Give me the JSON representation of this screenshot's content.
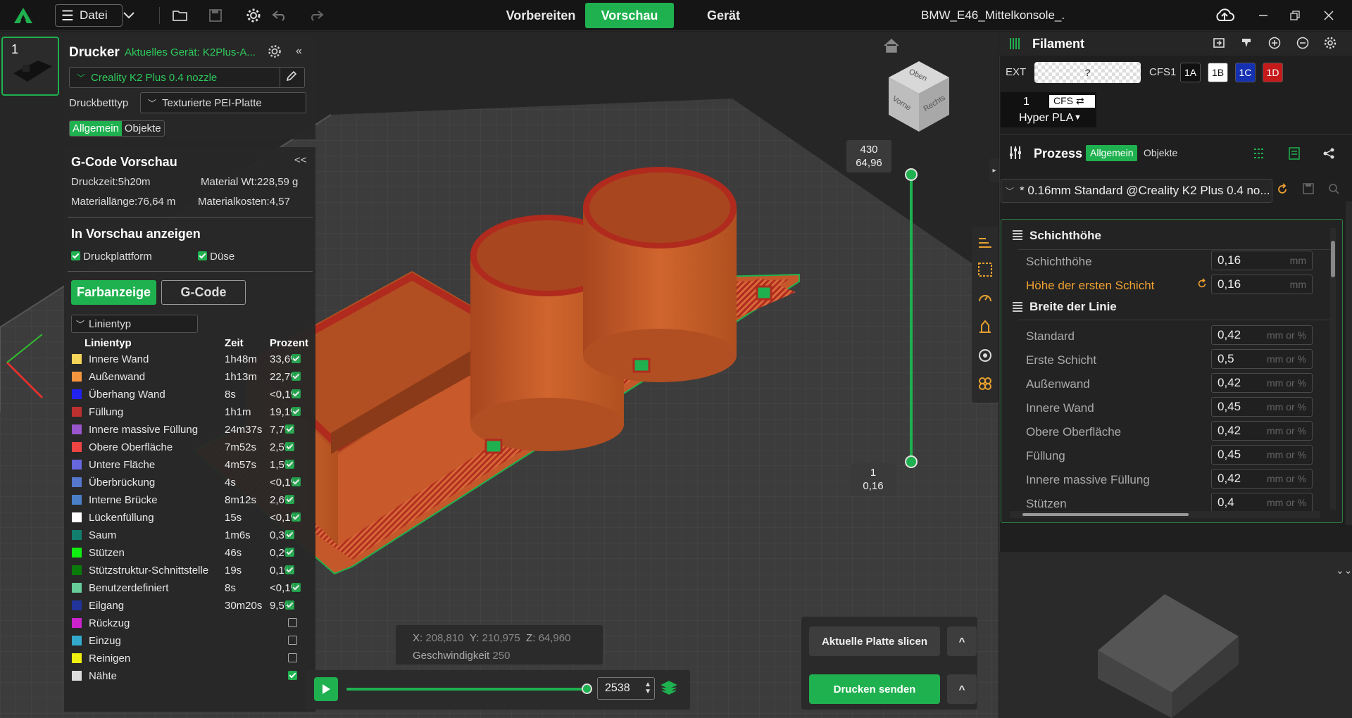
{
  "topbar": {
    "menu_label": "Datei",
    "tabs": [
      "Vorbereiten",
      "Vorschau",
      "Gerät"
    ],
    "active_tab": "Vorschau",
    "file_title": "BMW_E46_Mittelkonsole_."
  },
  "plate": {
    "number": "1"
  },
  "printer": {
    "title": "Drucker",
    "current_device": "Aktuelles Gerät: K2Plus-A...",
    "printer_select": "Creality K2 Plus 0.4 nozzle",
    "bed_label": "Druckbetttyp",
    "bed_value": "Texturierte PEI-Platte",
    "tabs": [
      "Allgemein",
      "Objekte"
    ]
  },
  "gcode_preview": {
    "title": "G-Code Vorschau",
    "collapse": "<<",
    "stats": {
      "print_time": "Druckzeit:5h20m",
      "material_wt": "Material Wt:228,59 g",
      "material_length": "Materiallänge:76,64 m",
      "material_cost": "Materialkosten:4,57"
    },
    "show_title": "In Vorschau anzeigen",
    "show_items": [
      "Druckplattform",
      "Düse"
    ],
    "view_tabs": [
      "Farbanzeige",
      "G-Code"
    ],
    "linetype_select": "Linientyp",
    "table": {
      "headers": [
        "Linientyp",
        "Zeit",
        "Prozent"
      ],
      "rows": [
        {
          "color": "#f5d45a",
          "name": "Innere Wand",
          "time": "1h48m",
          "pct": "33,6%"
        },
        {
          "color": "#f59540",
          "name": "Außenwand",
          "time": "1h13m",
          "pct": "22,7%"
        },
        {
          "color": "#2222ee",
          "name": "Überhang Wand",
          "time": "8s",
          "pct": "<0,1%"
        },
        {
          "color": "#bb3030",
          "name": "Füllung",
          "time": "1h1m",
          "pct": "19,1%"
        },
        {
          "color": "#9955cc",
          "name": "Innere massive Füllung",
          "time": "24m37s",
          "pct": "7,7%"
        },
        {
          "color": "#ee4444",
          "name": "Obere Oberfläche",
          "time": "7m52s",
          "pct": "2,5%"
        },
        {
          "color": "#6666dd",
          "name": "Untere Fläche",
          "time": "4m57s",
          "pct": "1,5%"
        },
        {
          "color": "#5577cc",
          "name": "Überbrückung",
          "time": "4s",
          "pct": "<0,1%"
        },
        {
          "color": "#4a7fc8",
          "name": "Interne Brücke",
          "time": "8m12s",
          "pct": "2,6%"
        },
        {
          "color": "#ffffff",
          "name": "Lückenfüllung",
          "time": "15s",
          "pct": "<0,1%"
        },
        {
          "color": "#127f6e",
          "name": "Saum",
          "time": "1m6s",
          "pct": "0,3%"
        },
        {
          "color": "#11ee11",
          "name": "Stützen",
          "time": "46s",
          "pct": "0,2%"
        },
        {
          "color": "#0a7a0a",
          "name": "Stützstruktur-Schnittstelle",
          "time": "19s",
          "pct": "0,1%"
        },
        {
          "color": "#66cc99",
          "name": "Benutzerdefiniert",
          "time": "8s",
          "pct": "<0,1%"
        },
        {
          "color": "#223399",
          "name": "Eilgang",
          "time": "30m20s",
          "pct": "9,5%"
        },
        {
          "color": "#cc22cc",
          "name": "Rückzug",
          "time": "",
          "pct": ""
        },
        {
          "color": "#33aacc",
          "name": "Einzug",
          "time": "",
          "pct": ""
        },
        {
          "color": "#eeee11",
          "name": "Reinigen",
          "time": "",
          "pct": ""
        },
        {
          "color": "#dddddd",
          "name": "Nähte",
          "time": "",
          "pct": ""
        }
      ]
    }
  },
  "layer_slider": {
    "top_layer": "430",
    "top_height": "64,96",
    "bottom_layer": "1",
    "bottom_height": "0,16"
  },
  "view_cube": {
    "top": "Oben",
    "front": "Vorne",
    "right": "Rechts"
  },
  "status": {
    "x": "208,810",
    "y": "210,975",
    "z": "64,960",
    "speed_label": "Geschwindigkeit",
    "speed": "250",
    "x_label": "X:",
    "y_label": "Y:",
    "z_label": "Z:"
  },
  "playback": {
    "move_value": "2538"
  },
  "actions": {
    "slice_label": "Aktuelle Platte slicen",
    "send_label": "Drucken senden",
    "caret": "^"
  },
  "filament": {
    "title": "Filament",
    "ext_label": "EXT",
    "ext_value": "?",
    "cfs_label": "CFS1",
    "slots": [
      {
        "label": "1A",
        "bg": "#111111",
        "fg": "#ffffff"
      },
      {
        "label": "1B",
        "bg": "#ffffff",
        "fg": "#111111"
      },
      {
        "label": "1C",
        "bg": "#1530b0",
        "fg": "#ffffff"
      },
      {
        "label": "1D",
        "bg": "#c41a1a",
        "fg": "#ffffff"
      }
    ],
    "slot_number": "1",
    "slot_source": "CFS",
    "material": "Hyper PLA"
  },
  "process": {
    "title": "Prozess",
    "tabs": [
      "Allgemein",
      "Objekte"
    ],
    "preset": "* 0.16mm Standard @Creality K2 Plus 0.4 no...",
    "section1": "Schichthöhe",
    "section2": "Breite der Linie",
    "unit_mm": "mm",
    "unit_mm_pct": "mm or %",
    "params_layer": [
      {
        "label": "Schichthöhe",
        "value": "0,16",
        "modified": false
      },
      {
        "label": "Höhe der ersten Schicht",
        "value": "0,16",
        "modified": true
      }
    ],
    "params_width": [
      {
        "label": "Standard",
        "value": "0,42"
      },
      {
        "label": "Erste Schicht",
        "value": "0,5"
      },
      {
        "label": "Außenwand",
        "value": "0,42"
      },
      {
        "label": "Innere Wand",
        "value": "0,45"
      },
      {
        "label": "Obere Oberfläche",
        "value": "0,42"
      },
      {
        "label": "Füllung",
        "value": "0,45"
      },
      {
        "label": "Innere massive Füllung",
        "value": "0,42"
      },
      {
        "label": "Stützen",
        "value": "0,4"
      }
    ]
  },
  "colors": {
    "accent": "#1fb14f",
    "modified": "#f0a030",
    "model_orange": "#c8582a",
    "model_red": "#a82a1e"
  }
}
